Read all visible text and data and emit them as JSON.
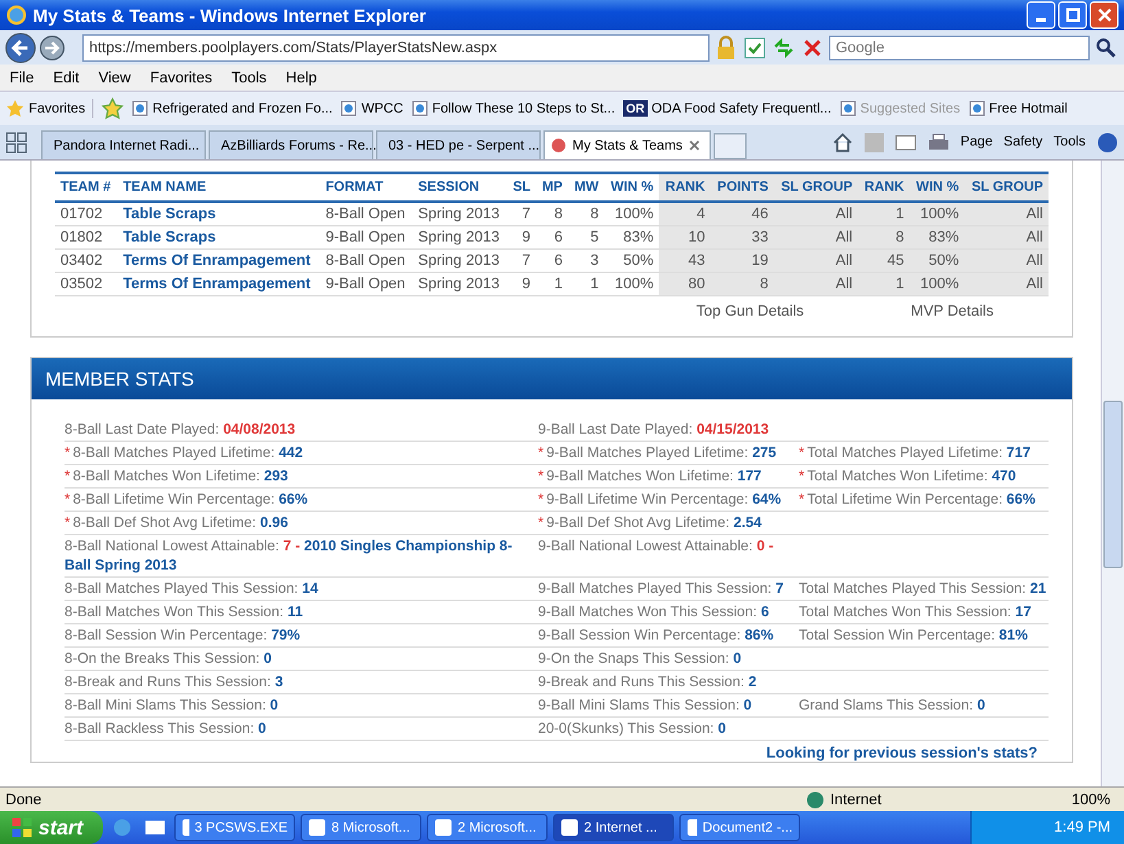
{
  "window": {
    "title": "My Stats & Teams - Windows Internet Explorer"
  },
  "address_bar": {
    "url": "https://members.poolplayers.com/Stats/PlayerStatsNew.aspx",
    "search_placeholder": "Google"
  },
  "menu": [
    "File",
    "Edit",
    "View",
    "Favorites",
    "Tools",
    "Help"
  ],
  "favorites_bar": {
    "label": "Favorites",
    "items": [
      {
        "label": "Refrigerated and Frozen Fo...",
        "kind": "page"
      },
      {
        "label": "WPCC",
        "kind": "page"
      },
      {
        "label": "Follow These 10 Steps to St...",
        "kind": "page"
      },
      {
        "label": "ODA Food Safety Frequentl...",
        "kind": "badge",
        "badge": "OR"
      },
      {
        "label": "Suggested Sites",
        "kind": "dim"
      },
      {
        "label": "Free Hotmail",
        "kind": "page"
      }
    ]
  },
  "tabs": [
    {
      "label": "Pandora Internet Radi...",
      "selected": false
    },
    {
      "label": "AzBilliards Forums - Re...",
      "selected": false
    },
    {
      "label": "03 - HED pe - Serpent ...",
      "selected": false
    },
    {
      "label": "My Stats & Teams",
      "selected": true
    }
  ],
  "command_bar": [
    "Page",
    "Safety",
    "Tools"
  ],
  "teams_table": {
    "columns": [
      {
        "label": "TEAM #",
        "kind": "text",
        "shaded": false
      },
      {
        "label": "TEAM NAME",
        "kind": "link",
        "shaded": false
      },
      {
        "label": "FORMAT",
        "kind": "text",
        "shaded": false
      },
      {
        "label": "SESSION",
        "kind": "text",
        "shaded": false
      },
      {
        "label": "SL",
        "kind": "num",
        "shaded": false
      },
      {
        "label": "MP",
        "kind": "num",
        "shaded": false
      },
      {
        "label": "MW",
        "kind": "num",
        "shaded": false
      },
      {
        "label": "WIN %",
        "kind": "num",
        "shaded": false
      },
      {
        "label": "RANK",
        "kind": "num",
        "shaded": true
      },
      {
        "label": "POINTS",
        "kind": "num",
        "shaded": true
      },
      {
        "label": "SL GROUP",
        "kind": "num",
        "shaded": true
      },
      {
        "label": "RANK",
        "kind": "num",
        "shaded": true
      },
      {
        "label": "WIN %",
        "kind": "num",
        "shaded": true
      },
      {
        "label": "SL GROUP",
        "kind": "num",
        "shaded": true
      }
    ],
    "rows": [
      [
        "01702",
        "Table Scraps",
        "8-Ball Open",
        "Spring 2013",
        "7",
        "8",
        "8",
        "100%",
        "4",
        "46",
        "All",
        "1",
        "100%",
        "All"
      ],
      [
        "01802",
        "Table Scraps",
        "9-Ball Open",
        "Spring 2013",
        "9",
        "6",
        "5",
        "83%",
        "10",
        "33",
        "All",
        "8",
        "83%",
        "All"
      ],
      [
        "03402",
        "Terms Of Enrampagement",
        "8-Ball Open",
        "Spring 2013",
        "7",
        "6",
        "3",
        "50%",
        "43",
        "19",
        "All",
        "45",
        "50%",
        "All"
      ],
      [
        "03502",
        "Terms Of Enrampagement",
        "9-Ball Open",
        "Spring 2013",
        "9",
        "1",
        "1",
        "100%",
        "80",
        "8",
        "All",
        "1",
        "100%",
        "All"
      ]
    ],
    "links": [
      "Top Gun Details",
      "MVP Details"
    ]
  },
  "member_stats": {
    "title": "MEMBER STATS",
    "rows": [
      [
        {
          "label": "8-Ball Last Date Played: ",
          "parts": [
            {
              "text": "04/08/2013",
              "color": "#e03838"
            }
          ]
        },
        {
          "label": "9-Ball Last Date Played: ",
          "parts": [
            {
              "text": "04/15/2013",
              "color": "#e03838"
            }
          ]
        },
        null
      ],
      [
        {
          "mark": "*",
          "label": "8-Ball Matches Played Lifetime: ",
          "parts": [
            {
              "text": "442",
              "color": "#1a5aa0"
            }
          ]
        },
        {
          "mark": "*",
          "label": "9-Ball Matches Played Lifetime: ",
          "parts": [
            {
              "text": "275",
              "color": "#1a5aa0"
            }
          ]
        },
        {
          "mark": "*",
          "label": "Total Matches Played Lifetime: ",
          "parts": [
            {
              "text": "717",
              "color": "#1a5aa0"
            }
          ]
        }
      ],
      [
        {
          "mark": "*",
          "label": "8-Ball Matches Won Lifetime: ",
          "parts": [
            {
              "text": "293",
              "color": "#1a5aa0"
            }
          ]
        },
        {
          "mark": "*",
          "label": "9-Ball Matches Won Lifetime: ",
          "parts": [
            {
              "text": "177",
              "color": "#1a5aa0"
            }
          ]
        },
        {
          "mark": "*",
          "label": "Total Matches Won Lifetime: ",
          "parts": [
            {
              "text": "470",
              "color": "#1a5aa0"
            }
          ]
        }
      ],
      [
        {
          "mark": "*",
          "label": "8-Ball Lifetime Win Percentage: ",
          "parts": [
            {
              "text": "66%",
              "color": "#1a5aa0"
            }
          ]
        },
        {
          "mark": "*",
          "label": "9-Ball Lifetime Win Percentage: ",
          "parts": [
            {
              "text": "64%",
              "color": "#1a5aa0"
            }
          ]
        },
        {
          "mark": "*",
          "label": "Total Lifetime Win Percentage: ",
          "parts": [
            {
              "text": "66%",
              "color": "#1a5aa0"
            }
          ]
        }
      ],
      [
        {
          "mark": "*",
          "label": "8-Ball Def Shot Avg Lifetime: ",
          "parts": [
            {
              "text": "0.96",
              "color": "#1a5aa0"
            }
          ]
        },
        {
          "mark": "*",
          "label": "9-Ball Def Shot Avg Lifetime: ",
          "parts": [
            {
              "text": "2.54",
              "color": "#1a5aa0"
            }
          ]
        },
        null
      ],
      [
        {
          "label": "8-Ball National Lowest Attainable: ",
          "parts": [
            {
              "text": "7",
              "color": "#e03838"
            },
            {
              "text": " - ",
              "color": "#e03838"
            },
            {
              "text": "2010 Singles Championship 8-Ball Spring 2013",
              "color": "#1a5aa0"
            }
          ]
        },
        {
          "label": "9-Ball National Lowest Attainable: ",
          "parts": [
            {
              "text": "0",
              "color": "#e03838"
            },
            {
              "text": " -",
              "color": "#e03838"
            }
          ]
        },
        null
      ],
      [
        {
          "label": "8-Ball Matches Played This Session: ",
          "parts": [
            {
              "text": "14",
              "color": "#1a5aa0"
            }
          ]
        },
        {
          "label": "9-Ball Matches Played This Session: ",
          "parts": [
            {
              "text": "7",
              "color": "#1a5aa0"
            }
          ]
        },
        {
          "label": "Total Matches Played This Session: ",
          "parts": [
            {
              "text": "21",
              "color": "#1a5aa0"
            }
          ]
        }
      ],
      [
        {
          "label": "8-Ball Matches Won This Session: ",
          "parts": [
            {
              "text": "11",
              "color": "#1a5aa0"
            }
          ]
        },
        {
          "label": "9-Ball Matches Won This Session: ",
          "parts": [
            {
              "text": "6",
              "color": "#1a5aa0"
            }
          ]
        },
        {
          "label": "Total Matches Won This Session: ",
          "parts": [
            {
              "text": "17",
              "color": "#1a5aa0"
            }
          ]
        }
      ],
      [
        {
          "label": "8-Ball Session Win Percentage: ",
          "parts": [
            {
              "text": "79%",
              "color": "#1a5aa0"
            }
          ]
        },
        {
          "label": "9-Ball Session Win Percentage: ",
          "parts": [
            {
              "text": "86%",
              "color": "#1a5aa0"
            }
          ]
        },
        {
          "label": "Total Session Win Percentage: ",
          "parts": [
            {
              "text": "81%",
              "color": "#1a5aa0"
            }
          ]
        }
      ],
      [
        {
          "label": "8-On the Breaks This Session: ",
          "parts": [
            {
              "text": "0",
              "color": "#1a5aa0"
            }
          ]
        },
        {
          "label": "9-On the Snaps This Session: ",
          "parts": [
            {
              "text": "0",
              "color": "#1a5aa0"
            }
          ]
        },
        null
      ],
      [
        {
          "label": "8-Break and Runs This Session: ",
          "parts": [
            {
              "text": "3",
              "color": "#1a5aa0"
            }
          ]
        },
        {
          "label": "9-Break and Runs This Session: ",
          "parts": [
            {
              "text": "2",
              "color": "#1a5aa0"
            }
          ]
        },
        null
      ],
      [
        {
          "label": "8-Ball Mini Slams This Session: ",
          "parts": [
            {
              "text": "0",
              "color": "#1a5aa0"
            }
          ]
        },
        {
          "label": "9-Ball Mini Slams This Session: ",
          "parts": [
            {
              "text": "0",
              "color": "#1a5aa0"
            }
          ]
        },
        {
          "label": "Grand Slams This Session: ",
          "parts": [
            {
              "text": "0",
              "color": "#1a5aa0"
            }
          ]
        }
      ],
      [
        {
          "label": "8-Ball Rackless This Session: ",
          "parts": [
            {
              "text": "0",
              "color": "#1a5aa0"
            }
          ]
        },
        {
          "label": "20-0(Skunks) This Session: ",
          "parts": [
            {
              "text": "0",
              "color": "#1a5aa0"
            }
          ]
        },
        null
      ]
    ],
    "previous_link": "Looking for previous session's stats?"
  },
  "status_bar": {
    "status": "Done",
    "zone": "Internet",
    "zoom": "100%"
  },
  "taskbar": {
    "start": "start",
    "tasks": [
      {
        "label": "3 PCSWS.EXE",
        "selected": false
      },
      {
        "label": "8 Microsoft...",
        "selected": false
      },
      {
        "label": "2 Microsoft...",
        "selected": false
      },
      {
        "label": "2 Internet ...",
        "selected": true
      },
      {
        "label": "Document2 -...",
        "selected": false
      }
    ],
    "time": "1:49 PM"
  }
}
